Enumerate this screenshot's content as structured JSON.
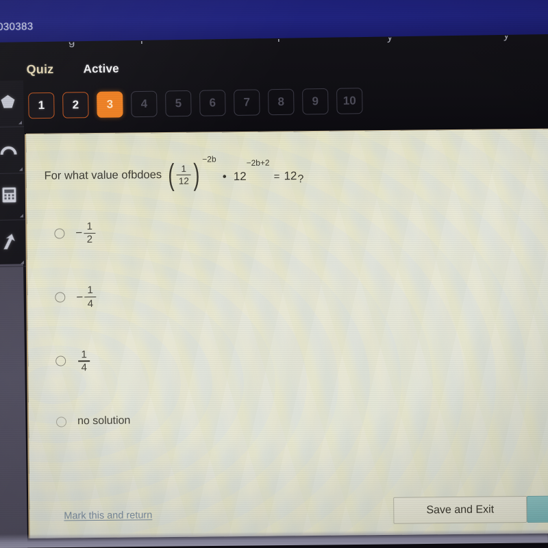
{
  "browser": {
    "tab_id_fragment": "030383",
    "clipped_glyphs": [
      "g",
      "l",
      "l",
      "y",
      "y"
    ]
  },
  "nav": {
    "quiz_label": "Quiz",
    "status_label": "Active",
    "questions": [
      {
        "number": "1",
        "state": "answered"
      },
      {
        "number": "2",
        "state": "answered"
      },
      {
        "number": "3",
        "state": "current"
      },
      {
        "number": "4",
        "state": "locked"
      },
      {
        "number": "5",
        "state": "locked"
      },
      {
        "number": "6",
        "state": "locked"
      },
      {
        "number": "7",
        "state": "locked"
      },
      {
        "number": "8",
        "state": "locked"
      },
      {
        "number": "9",
        "state": "locked"
      },
      {
        "number": "10",
        "state": "locked"
      }
    ]
  },
  "tools": [
    {
      "name": "shape-tool-icon"
    },
    {
      "name": "protractor-icon"
    },
    {
      "name": "calculator-icon"
    },
    {
      "name": "pointer-arrow-icon"
    }
  ],
  "question": {
    "lead_text": "For what value of ",
    "variable": "b",
    "mid_text": " does ",
    "fraction_numerator": "1",
    "fraction_denominator": "12",
    "outer_exponent": "−2b",
    "multiply_symbol": "•",
    "second_base": "12",
    "second_exponent": "−2b+2",
    "equals": "=",
    "right_side": "12",
    "question_mark": "?"
  },
  "options": [
    {
      "id": "a",
      "sign": "−",
      "numerator": "1",
      "denominator": "2",
      "kind": "fraction",
      "selected": false
    },
    {
      "id": "b",
      "sign": "−",
      "numerator": "1",
      "denominator": "4",
      "kind": "fraction",
      "selected": false
    },
    {
      "id": "c",
      "sign": "",
      "numerator": "1",
      "denominator": "4",
      "kind": "fraction",
      "selected": false
    },
    {
      "id": "d",
      "text": "no solution",
      "kind": "text",
      "selected": false
    }
  ],
  "footer": {
    "mark_link": "Mark this and return",
    "save_exit_label": "Save and Exit",
    "next_label": ""
  },
  "colors": {
    "browser_blue": "#20237f",
    "accent_orange": "#f08022",
    "quiz_cream": "#e8dcb8",
    "card_beige": "#e6e5d4",
    "link_blue": "#7d8fa1",
    "next_teal": "#8fc4c4"
  }
}
